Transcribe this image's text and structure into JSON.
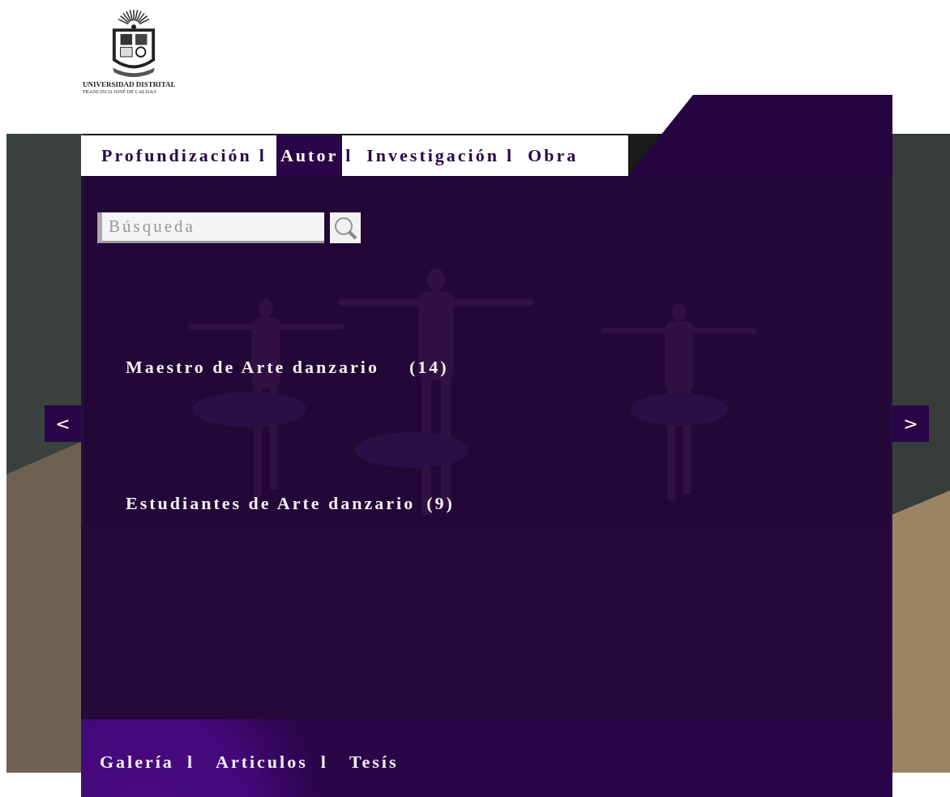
{
  "logo": {
    "line_1": "UNIVERSIDAD DISTRITAL",
    "line_2": "FRANCISCO JOSÉ DE CALDAS"
  },
  "tabs": [
    {
      "label": "Profundización",
      "selected": false,
      "separator": "l"
    },
    {
      "label": "Autor",
      "selected": true,
      "separator": "l"
    },
    {
      "label": "Investigación",
      "selected": false,
      "separator": "l"
    },
    {
      "label": "Obra",
      "selected": false
    }
  ],
  "search": {
    "placeholder": "Búsqueda"
  },
  "categories": [
    {
      "label": "Maestro de Arte danzario",
      "count": "(14)"
    },
    {
      "label": "Estudiantes de Arte danzario",
      "count": "(9)"
    }
  ],
  "carousel": {
    "previous": "<",
    "next": ">"
  },
  "footer_links": [
    {
      "label": "Galería",
      "separator": "l"
    },
    {
      "label": "Articulos",
      "separator": "l"
    },
    {
      "label": "Tesís"
    }
  ]
}
